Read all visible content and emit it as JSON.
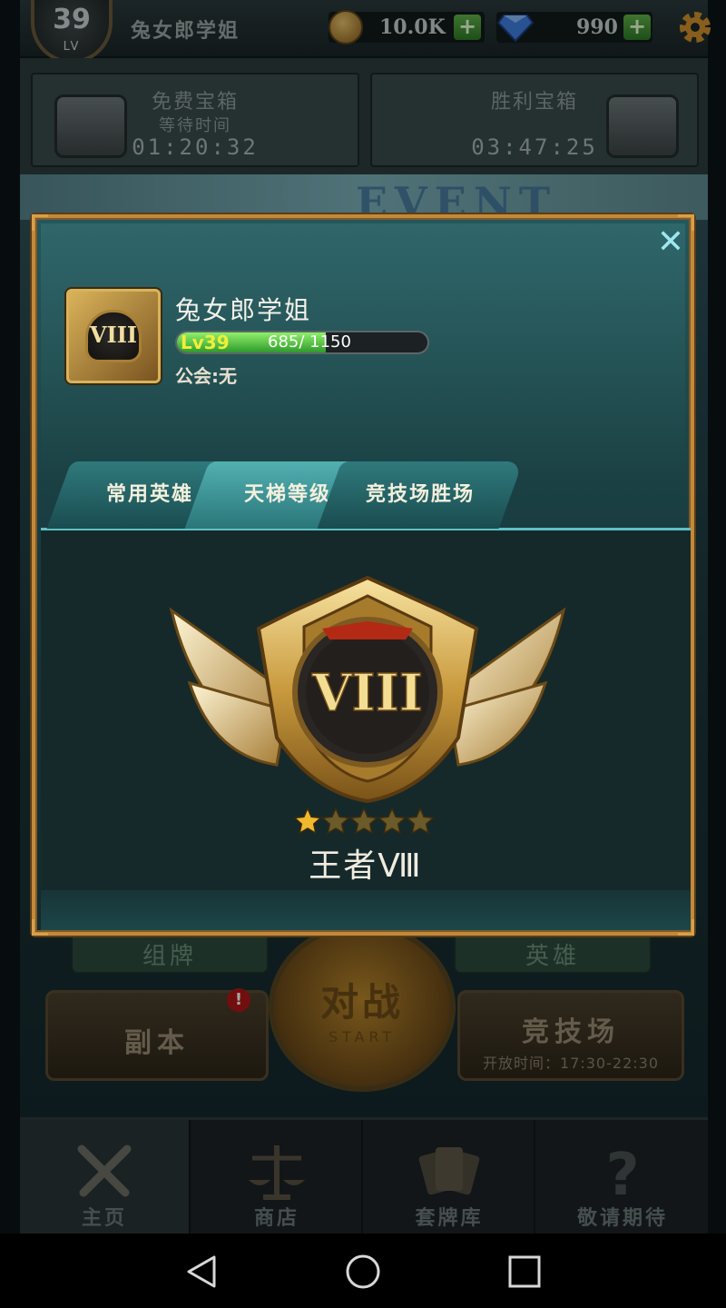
{
  "player": {
    "level_num": "39",
    "level_label": "LV",
    "name": "兔女郎学姐"
  },
  "currency": {
    "gold": "10.0K",
    "gems": "990",
    "plus": "+"
  },
  "chests": {
    "free": {
      "title": "免费宝箱",
      "subtitle": "等待时间",
      "time": "01:20:32"
    },
    "victory": {
      "title": "胜利宝箱",
      "time": "03:47:25"
    }
  },
  "event_banner": "EVENT",
  "home": {
    "tab_deck": "组牌",
    "tab_hero": "英雄",
    "dungeon": "副本",
    "dungeon_alert": "!",
    "battle": "对战",
    "battle_sub": "START",
    "arena": "竞技场",
    "arena_hours": "开放时间：17:30-22:30"
  },
  "nav": {
    "items": [
      {
        "label": "主页",
        "icon": "crossed-swords-icon"
      },
      {
        "label": "商店",
        "icon": "scales-icon"
      },
      {
        "label": "套牌库",
        "icon": "cards-icon"
      },
      {
        "label": "敬请期待",
        "icon": "question-mark-icon"
      }
    ]
  },
  "profile_dialog": {
    "close": "✕",
    "avatar_rank": "VIII",
    "name": "兔女郎学姐",
    "level": "Lv39",
    "xp_text": "685/ 1150",
    "xp_current": 685,
    "xp_max": 1150,
    "guild": "公会:无",
    "tabs": [
      "常用英雄",
      "天梯等级",
      "竞技场胜场"
    ],
    "active_tab": 1,
    "rank_emblem": "VIII",
    "rank_stars_filled": 1,
    "rank_stars_total": 5,
    "rank_name": "王者Ⅷ"
  },
  "colors": {
    "dialog_border": "#c3893a",
    "tab_active": "#52b0b2",
    "xp_fill": "#2f9a2c",
    "level_text": "#f0ee3a",
    "star_filled": "#f0b92e",
    "star_empty": "#6b5a2a"
  }
}
